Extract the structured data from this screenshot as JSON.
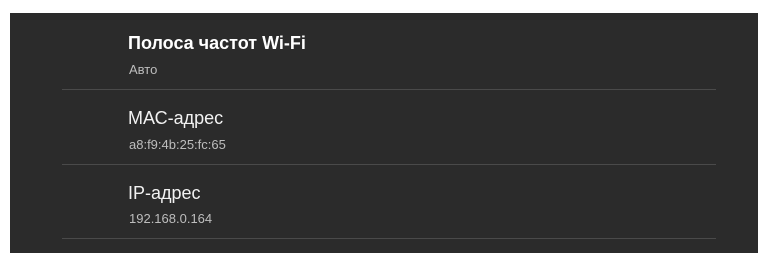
{
  "settings": {
    "items": [
      {
        "title": "Полоса частот Wi-Fi",
        "value": "Авто"
      },
      {
        "title": "МАС-адрес",
        "value": "a8:f9:4b:25:fc:65"
      },
      {
        "title": "IP-адрес",
        "value": "192.168.0.164"
      }
    ]
  }
}
